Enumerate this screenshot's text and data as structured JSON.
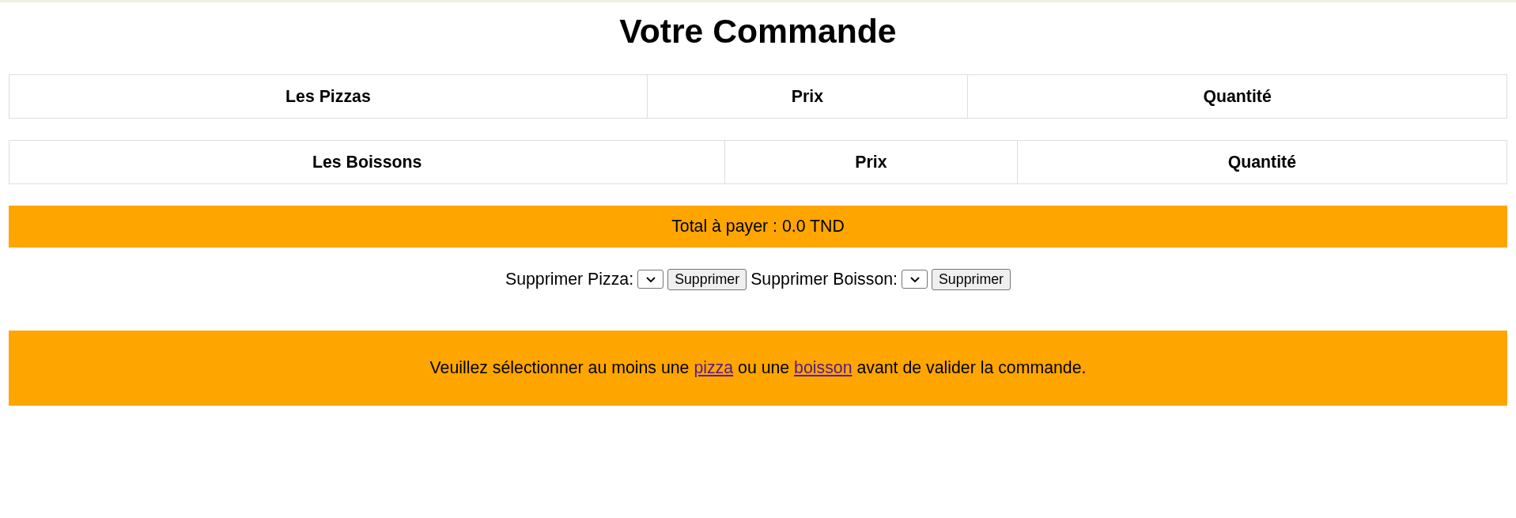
{
  "title": "Votre Commande",
  "tables": [
    {
      "columns": [
        "Les Pizzas",
        "Prix",
        "Quantité"
      ]
    },
    {
      "columns": [
        "Les Boissons",
        "Prix",
        "Quantité"
      ]
    }
  ],
  "total": "Total à payer : 0.0 TND",
  "remove_controls": [
    {
      "label": "Supprimer Pizza:",
      "button": "Supprimer"
    },
    {
      "label": "Supprimer Boisson:",
      "button": "Supprimer"
    }
  ],
  "notice": [
    {
      "kind": "text",
      "text": "Veuillez sélectionner au moins une"
    },
    {
      "kind": "link",
      "text": "pizza",
      "visited": true
    },
    {
      "kind": "text",
      "text": "ou une"
    },
    {
      "kind": "link",
      "text": "boisson",
      "visited": true
    },
    {
      "kind": "text",
      "text": "avant de valider la commande."
    }
  ]
}
